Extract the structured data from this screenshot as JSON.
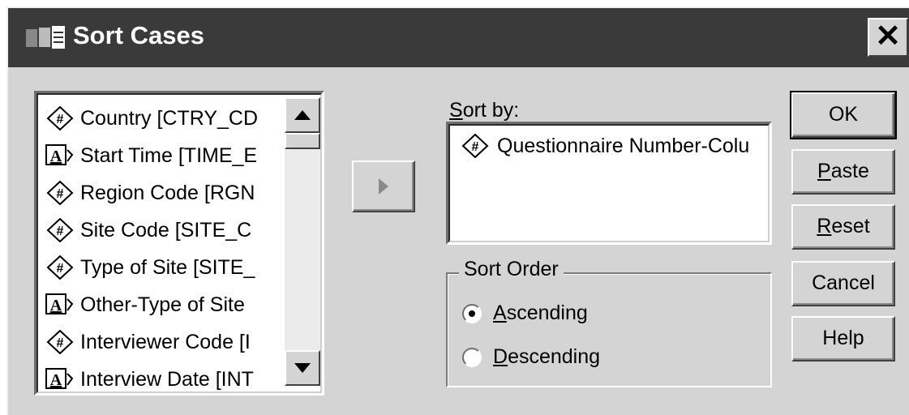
{
  "window": {
    "title": "Sort Cases",
    "close_glyph": "✕"
  },
  "variables": {
    "items": [
      {
        "label": "Country [CTRY_CD",
        "type": "numeric-icon"
      },
      {
        "label": "Start Time [TIME_E",
        "type": "string-icon"
      },
      {
        "label": "Region Code [RGN",
        "type": "numeric-icon"
      },
      {
        "label": "Site Code [SITE_C",
        "type": "numeric-icon"
      },
      {
        "label": "Type of Site [SITE_",
        "type": "numeric-icon"
      },
      {
        "label": "Other-Type of Site",
        "type": "string-icon"
      },
      {
        "label": "Interviewer Code [I",
        "type": "numeric-icon"
      },
      {
        "label": "Interview Date [INT",
        "type": "string-icon"
      }
    ]
  },
  "sort_by": {
    "label_mnemonic": "S",
    "label_rest": "ort by:",
    "items": [
      {
        "label": "Questionnaire Number-Colu",
        "type": "numeric-icon"
      }
    ]
  },
  "sort_order": {
    "title": "Sort Order",
    "ascending": {
      "mnemonic": "A",
      "rest": "scending",
      "checked": true
    },
    "descending": {
      "mnemonic": "D",
      "rest": "escending",
      "checked": false
    }
  },
  "buttons": {
    "ok": "OK",
    "paste": {
      "mnemonic": "P",
      "rest": "aste"
    },
    "reset": {
      "mnemonic": "R",
      "rest": "eset"
    },
    "cancel": "Cancel",
    "help": "Help"
  },
  "colors": {
    "titlebar": "#3a3a3a",
    "face": "#d4d4d4"
  }
}
